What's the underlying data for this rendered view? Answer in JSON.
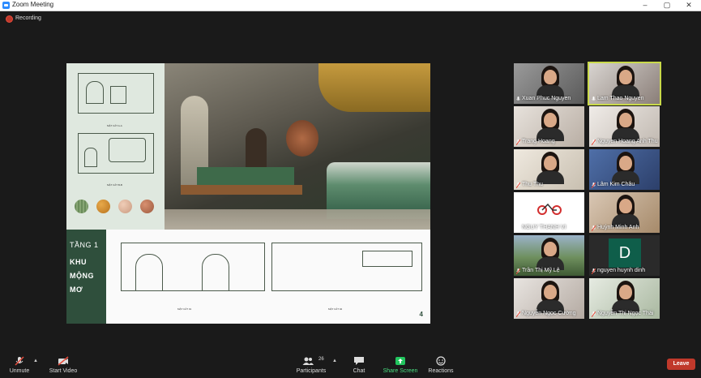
{
  "window": {
    "title": "Zoom Meeting"
  },
  "recording": {
    "label": "Recording"
  },
  "slide": {
    "floor_label": "TẦNG 1",
    "area_line1": "KHU",
    "area_line2": "MỘNG",
    "area_line3": "MƠ",
    "page_number": "4"
  },
  "participants": [
    {
      "name": "Xuan Phuc Nguyen",
      "muted": false,
      "active": false
    },
    {
      "name": "Lam Thao Nguyen",
      "muted": false,
      "active": true
    },
    {
      "name": "Trang Hoang",
      "muted": true,
      "active": false
    },
    {
      "name": "Nguyen Hoang Anh Thu",
      "muted": true,
      "active": false
    },
    {
      "name": "Thu Thu",
      "muted": true,
      "active": false
    },
    {
      "name": "Lâm Kim Châu",
      "muted": true,
      "active": false
    },
    {
      "name": "NGUY THANH VI",
      "muted": false,
      "active": false
    },
    {
      "name": "Huỳnh Minh Anh",
      "muted": true,
      "active": false
    },
    {
      "name": "Trần Thị Mỹ Lệ",
      "muted": true,
      "active": false
    },
    {
      "name": "nguyen huynh dinh",
      "muted": true,
      "active": false,
      "initial": "D"
    },
    {
      "name": "Nguyễn Ngọc Cường",
      "muted": true,
      "active": false
    },
    {
      "name": "Nguyễn Thị Ngọc Thái",
      "muted": true,
      "active": false
    }
  ],
  "toolbar": {
    "unmute": "Unmute",
    "start_video": "Start Video",
    "participants": "Participants",
    "participants_count": "26",
    "chat": "Chat",
    "share_screen": "Share Screen",
    "reactions": "Reactions",
    "leave": "Leave"
  },
  "colors": {
    "accent": "#2d8cff",
    "share_green": "#22c55e",
    "leave_red": "#c0392b",
    "active_border": "#c9d94a",
    "slide_green": "#2f4f3c"
  }
}
